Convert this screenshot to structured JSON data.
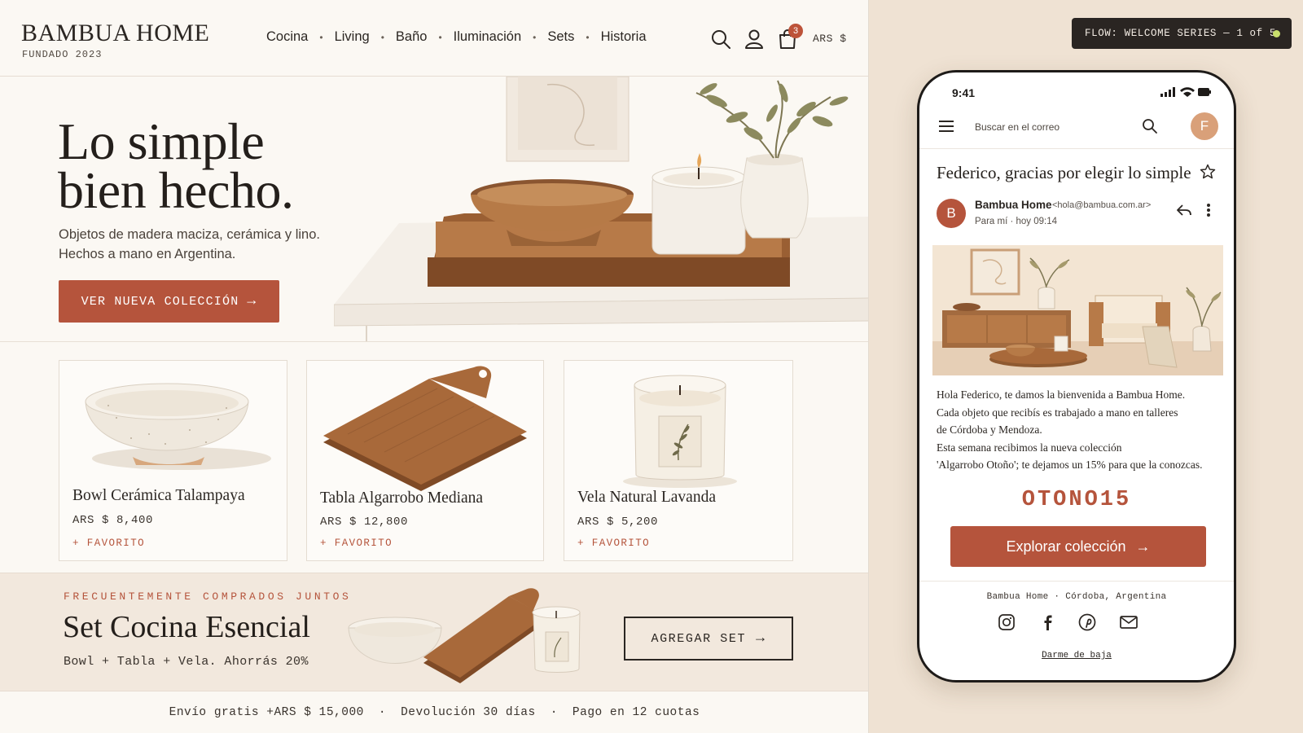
{
  "store": {
    "brand": "BAMBUA HOME",
    "tagline": "FUNDADO 2023",
    "nav": [
      "Cocina",
      "Living",
      "Baño",
      "Iluminación",
      "Sets",
      "Historia"
    ],
    "cart_count": "3",
    "currency": "ARS $",
    "hero": {
      "title_line1": "Lo simple",
      "title_line2": "bien hecho.",
      "subtitle_line1": "Objetos de madera maciza, cerámica y lino.",
      "subtitle_line2": "Hechos a mano en Argentina.",
      "cta": "VER NUEVA COLECCIÓN"
    },
    "products": [
      {
        "name": "Bowl Cerámica Talampaya",
        "price": "ARS $ 8,400",
        "fav": "+ FAVORITO"
      },
      {
        "name": "Tabla Algarrobo Mediana",
        "price": "ARS $ 12,800",
        "fav": "+ FAVORITO"
      },
      {
        "name": "Vela Natural Lavanda",
        "price": "ARS $ 5,200",
        "fav": "+ FAVORITO"
      }
    ],
    "bundle": {
      "eyebrow": "FRECUENTEMENTE COMPRADOS JUNTOS",
      "title": "Set Cocina Esencial",
      "subtitle": "Bowl + Tabla + Vela. Ahorrás 20%",
      "button": "AGREGAR SET"
    },
    "footer": [
      "Envío gratis +ARS $ 15,000",
      "Devolución 30 días",
      "Pago en 12 cuotas"
    ]
  },
  "flow": {
    "label": "FLOW: WELCOME SERIES — 1 of 5",
    "status_color": "#c9df6c"
  },
  "email": {
    "time": "9:41",
    "search_placeholder": "Buscar en el correo",
    "account_initial": "F",
    "subject": "Federico, gracias por elegir lo simple",
    "sender_initial": "B",
    "sender_name": "Bambua Home",
    "sender_email": "<hola@bambua.com.ar>",
    "to_line": "Para mí · hoy 09:14",
    "body": [
      "Hola Federico, te damos la bienvenida a Bambua Home.",
      "Cada objeto que recibís es trabajado a mano en talleres",
      "de Córdoba y Mendoza.",
      "Esta semana recibimos la nueva colección",
      "'Algarrobo Otoño'; te dejamos un 15% para que la conozcas."
    ],
    "code": "OTONO15",
    "cta": "Explorar colección",
    "address": "Bambua Home · Córdoba, Argentina",
    "social_icons": [
      "instagram-icon",
      "facebook-icon",
      "pinterest-icon",
      "mail-icon"
    ],
    "unsubscribe": "Darme de baja"
  },
  "colors": {
    "accent": "#b5543c",
    "panel_bg": "#fbf8f3",
    "page_bg": "#efe2d3",
    "dark": "#2a2522"
  }
}
